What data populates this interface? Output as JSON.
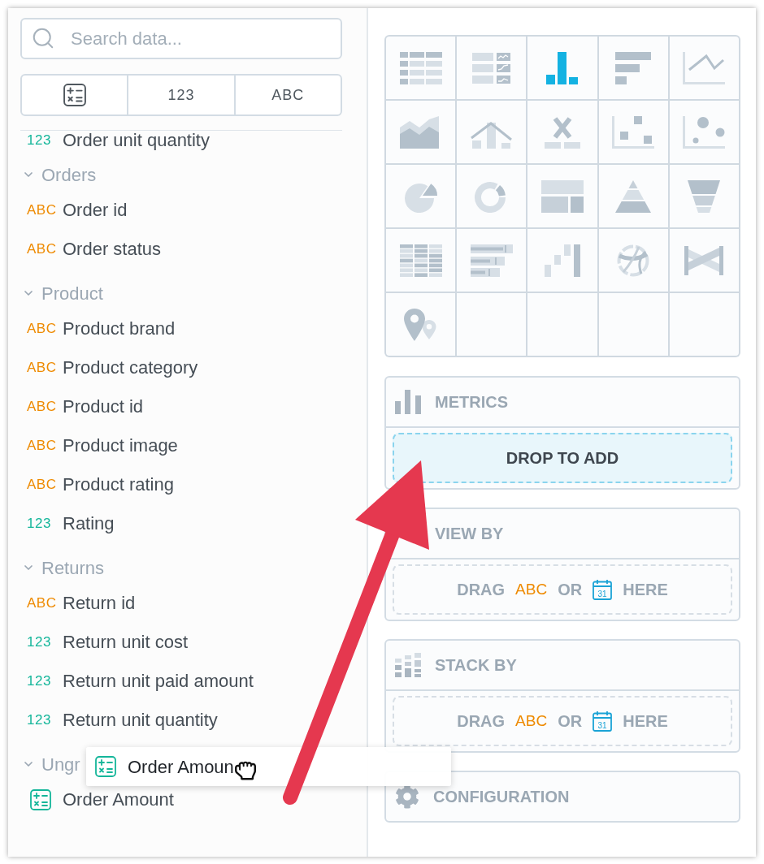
{
  "search": {
    "placeholder": "Search data..."
  },
  "type_filters": [
    {
      "kind": "metric"
    },
    {
      "kind": "fact",
      "label": "123"
    },
    {
      "kind": "attribute",
      "label": "ABC"
    }
  ],
  "field_list": [
    {
      "kind": "fact",
      "badge": "123",
      "label": "Order unit quantity"
    },
    {
      "kind": "group",
      "title": "Orders",
      "expanded": true,
      "children": [
        {
          "kind": "attribute",
          "badge": "ABC",
          "label": "Order id"
        },
        {
          "kind": "attribute",
          "badge": "ABC",
          "label": "Order status"
        }
      ]
    },
    {
      "kind": "group",
      "title": "Product",
      "expanded": true,
      "children": [
        {
          "kind": "attribute",
          "badge": "ABC",
          "label": "Product brand"
        },
        {
          "kind": "attribute",
          "badge": "ABC",
          "label": "Product category"
        },
        {
          "kind": "attribute",
          "badge": "ABC",
          "label": "Product id"
        },
        {
          "kind": "attribute",
          "badge": "ABC",
          "label": "Product image"
        },
        {
          "kind": "attribute",
          "badge": "ABC",
          "label": "Product rating"
        },
        {
          "kind": "fact",
          "badge": "123",
          "label": "Rating"
        }
      ]
    },
    {
      "kind": "group",
      "title": "Returns",
      "expanded": true,
      "children": [
        {
          "kind": "attribute",
          "badge": "ABC",
          "label": "Return id"
        },
        {
          "kind": "fact",
          "badge": "123",
          "label": "Return unit cost"
        },
        {
          "kind": "fact",
          "badge": "123",
          "label": "Return unit paid amount"
        },
        {
          "kind": "fact",
          "badge": "123",
          "label": "Return unit quantity"
        }
      ]
    },
    {
      "kind": "group",
      "title": "Ungr",
      "expanded": true,
      "children": [
        {
          "kind": "metric",
          "label": "Order Amount"
        }
      ]
    }
  ],
  "drag_item": {
    "kind": "metric",
    "label": "Order Amoun"
  },
  "chart_types": [
    {
      "kind": "table",
      "selected": false
    },
    {
      "kind": "repeater",
      "selected": false
    },
    {
      "kind": "column",
      "selected": true
    },
    {
      "kind": "bar",
      "selected": false
    },
    {
      "kind": "line",
      "selected": false
    },
    {
      "kind": "area",
      "selected": false
    },
    {
      "kind": "combo",
      "selected": false
    },
    {
      "kind": "headline",
      "selected": false
    },
    {
      "kind": "scatter",
      "selected": false
    },
    {
      "kind": "bubble",
      "selected": false
    },
    {
      "kind": "pie",
      "selected": false
    },
    {
      "kind": "donut",
      "selected": false
    },
    {
      "kind": "treemap",
      "selected": false
    },
    {
      "kind": "pyramid",
      "selected": false
    },
    {
      "kind": "funnel",
      "selected": false
    },
    {
      "kind": "heatmap",
      "selected": false
    },
    {
      "kind": "bullet",
      "selected": false
    },
    {
      "kind": "waterfall",
      "selected": false
    },
    {
      "kind": "dependency_wheel",
      "selected": false
    },
    {
      "kind": "sankey",
      "selected": false
    },
    {
      "kind": "geo",
      "selected": false
    }
  ],
  "sections": [
    {
      "kind": "metrics",
      "title": "METRICS",
      "dropzone": {
        "highlighted": true,
        "parts": [
          {
            "kind": "text",
            "text": "DROP TO ADD"
          }
        ]
      }
    },
    {
      "kind": "view_by",
      "title": "VIEW BY",
      "dropzone": {
        "highlighted": false,
        "parts": [
          {
            "kind": "text",
            "text": "DRAG"
          },
          {
            "kind": "attribute",
            "text": "ABC"
          },
          {
            "kind": "text",
            "text": "OR"
          },
          {
            "kind": "date",
            "text": "31"
          },
          {
            "kind": "text",
            "text": "HERE"
          }
        ]
      }
    },
    {
      "kind": "stack_by",
      "title": "STACK BY",
      "dropzone": {
        "highlighted": false,
        "parts": [
          {
            "kind": "text",
            "text": "DRAG"
          },
          {
            "kind": "attribute",
            "text": "ABC"
          },
          {
            "kind": "text",
            "text": "OR"
          },
          {
            "kind": "date",
            "text": "31"
          },
          {
            "kind": "text",
            "text": "HERE"
          }
        ]
      }
    },
    {
      "kind": "configuration",
      "title": "CONFIGURATION"
    }
  ]
}
